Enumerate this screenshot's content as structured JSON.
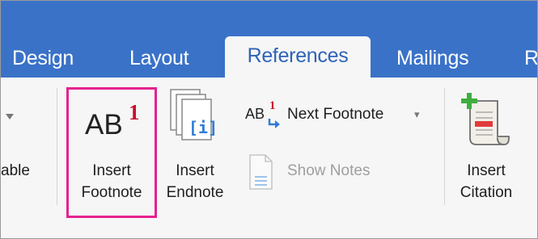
{
  "tabs": [
    {
      "label": "Design",
      "active": false
    },
    {
      "label": "Layout",
      "active": false
    },
    {
      "label": "References",
      "active": true
    },
    {
      "label": "Mailings",
      "active": false
    },
    {
      "label": "R",
      "active": false
    }
  ],
  "ribbon": {
    "partial_left_label": "able",
    "insert_footnote": {
      "line1": "Insert",
      "line2": "Footnote",
      "icon_text": "AB",
      "icon_sup": "1"
    },
    "insert_endnote": {
      "line1": "Insert",
      "line2": "Endnote",
      "icon_text": "[i]"
    },
    "next_footnote": {
      "label": "Next Footnote",
      "icon_text": "AB",
      "icon_sup": "1",
      "dropdown": "▾"
    },
    "show_notes": {
      "label": "Show Notes",
      "enabled": false
    },
    "insert_citation": {
      "line1": "Insert",
      "line2": "Citation"
    }
  },
  "colors": {
    "tab_bar": "#3a72c8",
    "active_tab_text": "#2f63b8",
    "highlight": "#e6218f",
    "superscript": "#c8102e"
  }
}
